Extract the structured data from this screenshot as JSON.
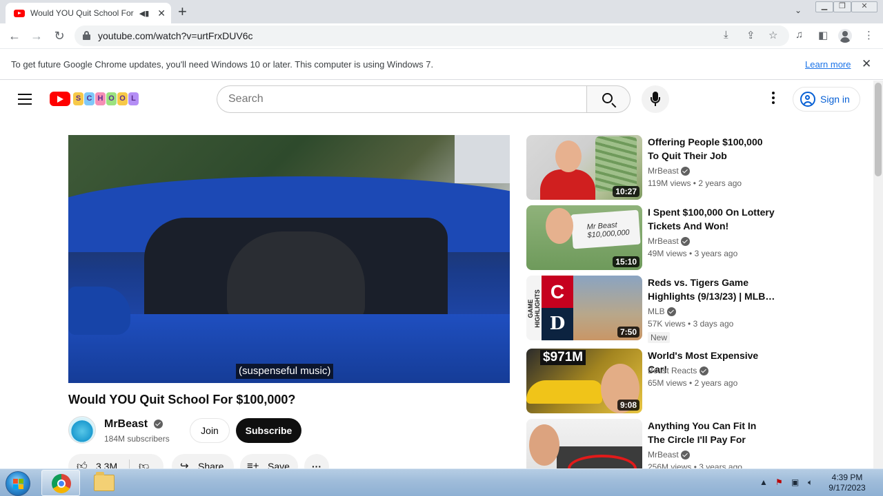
{
  "browser": {
    "tab_title": "Would YOU Quit School For",
    "url": "youtube.com/watch?v=urtFrxDUV6c",
    "infobar_message": "To get future Google Chrome updates, you'll need Windows 10 or later. This computer is using Windows 7.",
    "infobar_link": "Learn more"
  },
  "youtube": {
    "search_placeholder": "Search",
    "sign_in_label": "Sign in",
    "doodle_letters": [
      "S",
      "C",
      "H",
      "O",
      "O",
      "L"
    ]
  },
  "video": {
    "caption": "(suspenseful music)",
    "title": "Would YOU Quit School For $100,000?",
    "channel": "MrBeast",
    "subscribers": "184M subscribers",
    "join_label": "Join",
    "subscribe_label": "Subscribe",
    "like_count": "3.3M",
    "share_label": "Share",
    "save_label": "Save"
  },
  "recommendations": [
    {
      "title": "Offering People $100,000 To Quit Their Job",
      "channel": "MrBeast",
      "views": "119M views",
      "age": "2 years ago",
      "duration": "10:27"
    },
    {
      "title": "I Spent $100,000 On Lottery Tickets And Won!",
      "channel": "MrBeast",
      "views": "49M views",
      "age": "3 years ago",
      "duration": "15:10",
      "thumb_text": "Mr Beast $10,000,000"
    },
    {
      "title": "Reds vs. Tigers Game Highlights (9/13/23) | MLB…",
      "channel": "MLB",
      "views": "57K views",
      "age": "3 days ago",
      "duration": "7:50",
      "badge": "New",
      "thumb_text": "GAME HIGHLIGHTS"
    },
    {
      "title": "World's Most Expensive Car!",
      "channel": "Beast Reacts",
      "views": "65M views",
      "age": "2 years ago",
      "duration": "9:08",
      "thumb_text": "$971M"
    },
    {
      "title": "Anything You Can Fit In The Circle I'll Pay For",
      "channel": "MrBeast",
      "views": "256M views",
      "age": "3 years ago",
      "duration": ""
    }
  ],
  "taskbar": {
    "time": "4:39 PM",
    "date": "9/17/2023"
  },
  "colors": {
    "youtube_red": "#ff0000",
    "link_blue": "#065fd4",
    "chrome_tabstrip": "#dee1e6",
    "taskbar": "#9fbcda"
  }
}
